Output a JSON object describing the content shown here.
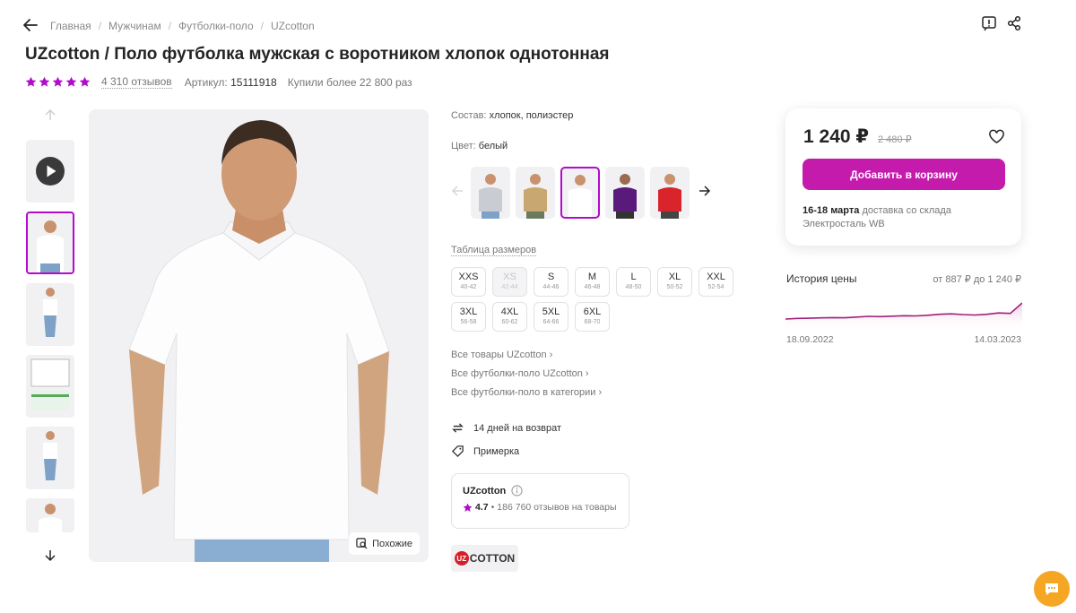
{
  "breadcrumb": [
    "Главная",
    "Мужчинам",
    "Футболки-поло",
    "UZcotton"
  ],
  "title": "UZcotton / Поло футболка мужская с воротником хлопок однотонная",
  "rating": {
    "stars": 5,
    "reviews": "4 310 отзывов",
    "article_label": "Артикул:",
    "article_value": "15111918",
    "bought": "Купили более 22 800 раз"
  },
  "similar_label": "Похожие",
  "composition": {
    "label": "Состав:",
    "value": "хлопок, полиэстер"
  },
  "color": {
    "label": "Цвет:",
    "value": "белый"
  },
  "color_swatches": [
    "#c9ccd3",
    "#c8a870",
    "#f4f4f6",
    "#5a1a7c",
    "#d9242b"
  ],
  "size_table_label": "Таблица размеров",
  "sizes": [
    {
      "name": "XXS",
      "range": "40-42",
      "available": true
    },
    {
      "name": "XS",
      "range": "42-44",
      "available": false
    },
    {
      "name": "S",
      "range": "44-46",
      "available": true
    },
    {
      "name": "M",
      "range": "46-48",
      "available": true
    },
    {
      "name": "L",
      "range": "48-50",
      "available": true
    },
    {
      "name": "XL",
      "range": "50-52",
      "available": true
    },
    {
      "name": "XXL",
      "range": "52-54",
      "available": true
    },
    {
      "name": "3XL",
      "range": "56-58",
      "available": true
    },
    {
      "name": "4XL",
      "range": "60-62",
      "available": true
    },
    {
      "name": "5XL",
      "range": "64-66",
      "available": true
    },
    {
      "name": "6XL",
      "range": "68-70",
      "available": true
    }
  ],
  "links": [
    "Все товары UZcotton",
    "Все футболки-поло UZcotton",
    "Все футболки-поло в категории"
  ],
  "perks": {
    "return": "14 дней на возврат",
    "fitting": "Примерка"
  },
  "seller": {
    "name": "UZcotton",
    "rating": "4.7",
    "reviews": "186 760 отзывов на товары"
  },
  "brand_logo": "COTTON",
  "price": {
    "current": "1 240 ₽",
    "old": "2 480 ₽",
    "cart_button": "Добавить в корзину",
    "delivery_date": "16-18 марта",
    "delivery_text": "доставка со склада",
    "delivery_city": "Электросталь WB"
  },
  "price_history": {
    "title": "История цены",
    "range": "от 887 ₽ до 1 240 ₽",
    "from": "18.09.2022",
    "to": "14.03.2023",
    "points": [
      887,
      900,
      905,
      912,
      918,
      915,
      930,
      945,
      940,
      950,
      960,
      955,
      970,
      990,
      1000,
      985,
      975,
      990,
      1020,
      1010,
      1240
    ]
  },
  "colors": {
    "accent": "#b10ccb",
    "cart": "#c41bad",
    "chart": "#a0207a",
    "chat": "#f5a623"
  }
}
